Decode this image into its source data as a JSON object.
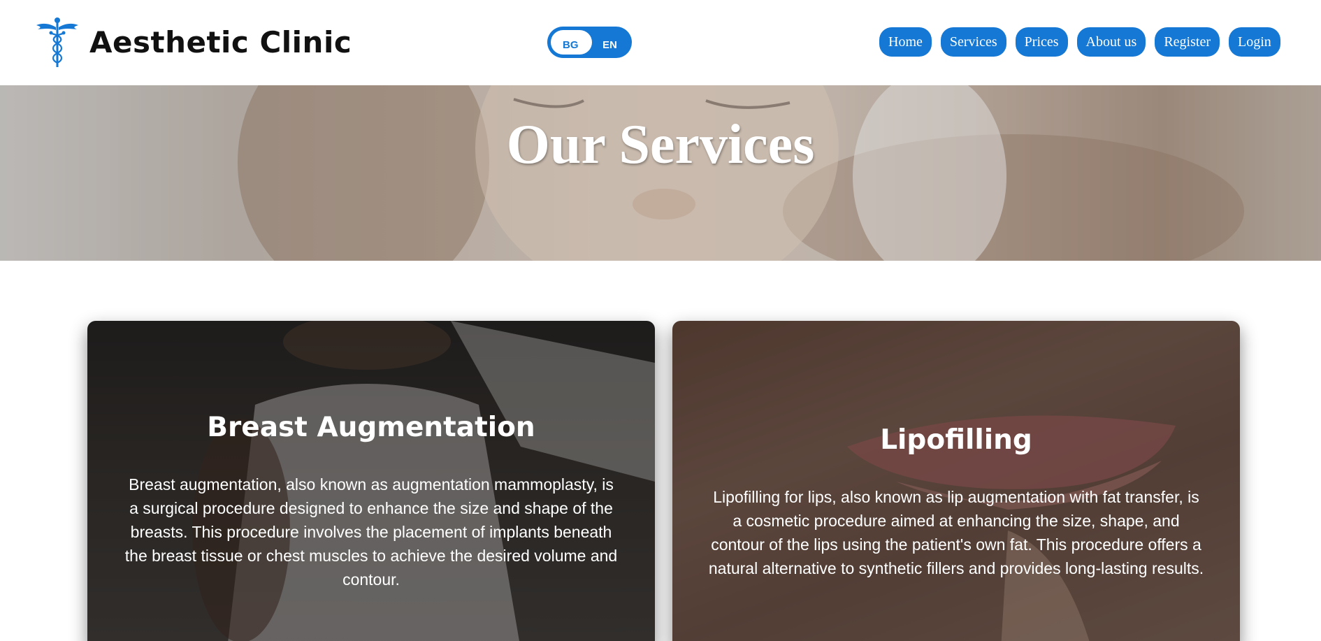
{
  "header": {
    "brand": "Aesthetic Clinic",
    "logo_icon": "caduceus-icon",
    "language": {
      "option_bg": "BG",
      "option_en": "EN"
    },
    "nav": [
      {
        "label": "Home"
      },
      {
        "label": "Services"
      },
      {
        "label": "Prices"
      },
      {
        "label": "About us"
      },
      {
        "label": "Register"
      },
      {
        "label": "Login"
      }
    ]
  },
  "hero": {
    "title": "Our Services"
  },
  "services": [
    {
      "title": "Breast Augmentation",
      "description": "Breast augmentation, also known as augmentation mammoplasty, is a surgical procedure designed to enhance the size and shape of the breasts. This procedure involves the placement of implants beneath the breast tissue or chest muscles to achieve the desired volume and contour."
    },
    {
      "title": "Lipofilling",
      "description": "Lipofilling for lips, also known as lip augmentation with fat transfer, is a cosmetic procedure aimed at enhancing the size, shape, and contour of the lips using the patient's own fat. This procedure offers a natural alternative to synthetic fillers and provides long-lasting results."
    }
  ],
  "colors": {
    "accent": "#1478d4",
    "text_light": "#ffffff"
  }
}
